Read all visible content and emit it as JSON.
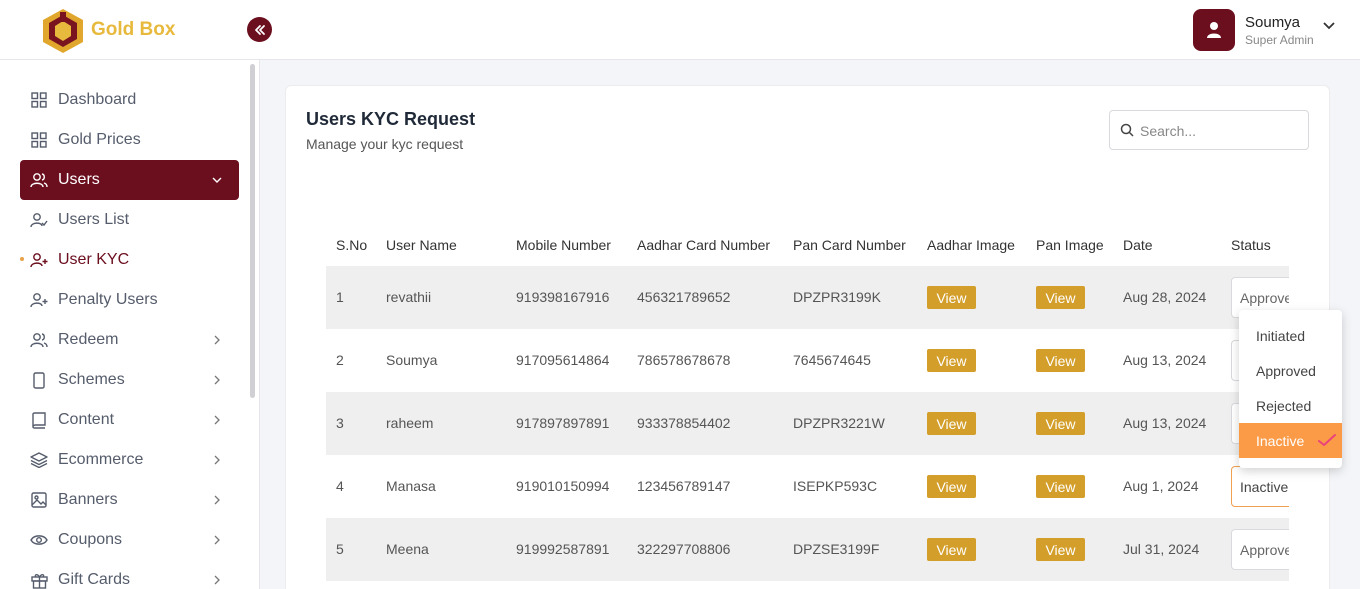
{
  "app": {
    "brand": "Gold Box"
  },
  "header": {
    "user_name": "Soumya",
    "user_role": "Super Admin"
  },
  "sidebar": {
    "items": [
      {
        "label": "Dashboard",
        "icon": "grid-icon"
      },
      {
        "label": "Gold Prices",
        "icon": "grid-icon"
      },
      {
        "label": "Users",
        "icon": "users-icon",
        "state": "expanded"
      },
      {
        "label": "Users List",
        "icon": "user-check-icon"
      },
      {
        "label": "User KYC",
        "icon": "user-plus-icon",
        "state": "current"
      },
      {
        "label": "Penalty Users",
        "icon": "user-plus-icon"
      },
      {
        "label": "Redeem",
        "icon": "users-icon"
      },
      {
        "label": "Schemes",
        "icon": "phone-icon"
      },
      {
        "label": "Content",
        "icon": "book-icon"
      },
      {
        "label": "Ecommerce",
        "icon": "layers-icon"
      },
      {
        "label": "Banners",
        "icon": "image-icon"
      },
      {
        "label": "Coupons",
        "icon": "eye-icon"
      },
      {
        "label": "Gift Cards",
        "icon": "gift-icon"
      }
    ]
  },
  "page": {
    "title": "Users KYC Request",
    "subtitle": "Manage your kyc request",
    "search_placeholder": "Search..."
  },
  "table": {
    "headers": [
      "S.No",
      "User Name",
      "Mobile Number",
      "Aadhar Card Number",
      "Pan Card Number",
      "Aadhar Image",
      "Pan Image",
      "Date",
      "Status"
    ],
    "view_label": "View",
    "rows": [
      {
        "sno": "1",
        "name": "revathii",
        "mobile": "919398167916",
        "aadhar": "456321789652",
        "pan": "DPZPR3199K",
        "date": "Aug 28, 2024",
        "status": "Approved"
      },
      {
        "sno": "2",
        "name": "Soumya",
        "mobile": "917095614864",
        "aadhar": "786578678678",
        "pan": "7645674645",
        "date": "Aug 13, 2024",
        "status": ""
      },
      {
        "sno": "3",
        "name": "raheem",
        "mobile": "917897897891",
        "aadhar": "933378854402",
        "pan": "DPZPR3221W",
        "date": "Aug 13, 2024",
        "status": ""
      },
      {
        "sno": "4",
        "name": "Manasa",
        "mobile": "919010150994",
        "aadhar": "123456789147",
        "pan": "ISEPKP593C",
        "date": "Aug 1, 2024",
        "status": "Inactive"
      },
      {
        "sno": "5",
        "name": "Meena",
        "mobile": "919992587891",
        "aadhar": "322297708806",
        "pan": "DPZSE3199F",
        "date": "Jul 31, 2024",
        "status": "Approved"
      }
    ]
  },
  "status_dropdown": {
    "options": [
      "Initiated",
      "Approved",
      "Rejected",
      "Inactive"
    ],
    "selected": "Inactive"
  },
  "colors": {
    "primary": "#6b0e1e",
    "gold": "#d39e2a",
    "brand_text": "#e7b93c",
    "selected_option": "#fb9b47"
  }
}
